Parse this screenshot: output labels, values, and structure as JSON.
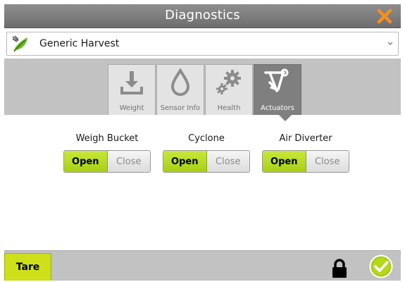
{
  "window": {
    "title": "Diagnostics",
    "close_icon": "close-x-icon",
    "accent_color": "#f5901e"
  },
  "selector": {
    "value": "Generic Harvest",
    "icon": "leaf-icon"
  },
  "tabs": [
    {
      "label": "Weight",
      "icon": "weight-download-icon",
      "active": false
    },
    {
      "label": "Sensor Info",
      "icon": "drop-icon",
      "active": false
    },
    {
      "label": "Health",
      "icon": "gears-icon",
      "active": false
    },
    {
      "label": "Actuators",
      "icon": "actuator-arm-icon",
      "active": true
    }
  ],
  "actuators": [
    {
      "label": "Weigh Bucket",
      "open_label": "Open",
      "close_label": "Close",
      "state": "Open"
    },
    {
      "label": "Cyclone",
      "open_label": "Open",
      "close_label": "Close",
      "state": "Open"
    },
    {
      "label": "Air Diverter",
      "open_label": "Open",
      "close_label": "Close",
      "state": "Open"
    }
  ],
  "bottom": {
    "tare_label": "Tare",
    "lock_icon": "lock-icon",
    "confirm_icon": "checkmark-circle-icon",
    "active_color": "#b5d81f"
  }
}
